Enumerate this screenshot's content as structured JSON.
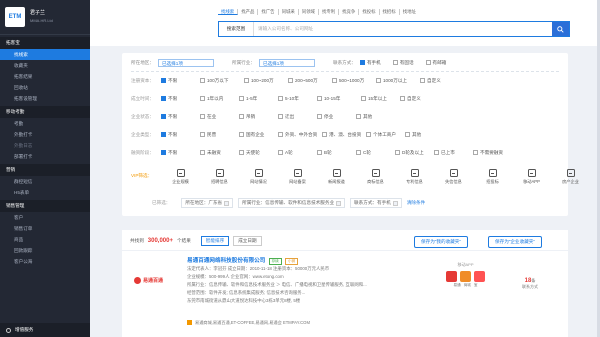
{
  "app": {
    "name": "君子兰",
    "sub": "MMA.HR.Ltd",
    "logo": "ETM"
  },
  "sidebar": {
    "sections": [
      {
        "title": "拓客宝",
        "items": [
          "找线索",
          "收藏夹",
          "拓客结果",
          "回收站",
          "拓客设管理"
        ]
      },
      {
        "title": "移动考勤",
        "items": [
          "考勤",
          "外勤打卡",
          "外勤日志",
          "部署打卡"
        ]
      },
      {
        "title": "营销",
        "items": [
          "群控短信",
          "H5表单"
        ]
      },
      {
        "title": "销售管理",
        "items": [
          "客户",
          "销售订单",
          "商品",
          "回款跟踪",
          "客户公海"
        ]
      }
    ],
    "active": "找线索",
    "dim": [
      "外勤日志"
    ],
    "bottom": "增值服务"
  },
  "top": {
    "tabs": [
      "找线索",
      "找产品",
      "找广告",
      "同城采",
      "同领域",
      "找专利",
      "找竞争",
      "找投标",
      "找招标",
      "找地址"
    ],
    "active": "找线索",
    "search_select": "搜索范围",
    "search_placeholder": "请输入公司名称、公司网址"
  },
  "filter": {
    "region_label": "所在地区：",
    "region_value": "已选择1项",
    "industry_label": "所属行业：",
    "industry_value": "已选择1项",
    "contact_label": "联系方式：",
    "contact_opts": [
      {
        "t": "有手机",
        "on": true
      },
      {
        "t": "有固话",
        "on": false
      },
      {
        "t": "有邮箱",
        "on": false
      }
    ],
    "rows": [
      {
        "label": "注册资本：",
        "opts": [
          "不限",
          "100万以下",
          "100~200万",
          "200~500万",
          "500~1000万",
          "1000万以上",
          "自定义"
        ]
      },
      {
        "label": "成立时间：",
        "opts": [
          "不限",
          "1年以内",
          "1-5年",
          "5-10年",
          "10-15年",
          "15年以上",
          "自定义"
        ]
      },
      {
        "label": "企业状态：",
        "opts": [
          "不限",
          "在业",
          "吊销",
          "迁出",
          "停业",
          "其他"
        ]
      },
      {
        "label": "企业类型：",
        "opts": [
          "不限",
          "民营",
          "国有企业",
          "外资、中外合资",
          "港、澳、台投资",
          "个体工商户",
          "其他"
        ]
      },
      {
        "label": "融资阶段：",
        "opts": [
          "不限",
          "未融资",
          "天使轮",
          "A轮",
          "B轮",
          "C轮",
          "D轮及以上",
          "已上市",
          "不需要融资"
        ]
      }
    ],
    "vip_label": "VIP筛选：",
    "vip_items": [
      "企业规模",
      "招聘信息",
      "网站情况",
      "网站备案",
      "新闻报道",
      "商标信息",
      "专利信息",
      "失信信息",
      "招投标",
      "移动APP",
      "房产企业"
    ],
    "chosen_label": "已筛选：",
    "chips": [
      "所在地区：广东省",
      "所属行业：信息传输、软件和信息技术服务业",
      "联系方式：有手机"
    ],
    "clear": "清除条件"
  },
  "results": {
    "prefix": "共找到",
    "count": "300,000+",
    "suffix": "个结果",
    "tabs": [
      "智能排序",
      "成立日期"
    ],
    "active_tab": "智能排序",
    "save1": "保存为\"我的收藏夹\"",
    "save2": "保存为\"企业收藏夹\"",
    "company": {
      "logo": "易通百通",
      "name": "易通百通网络科技股份有限公司",
      "badge1": "存续",
      "badge2": "小微",
      "line1": "法定代表人：李冠芬   成立日期：2010-11-18   注册资本：50000万元人民币",
      "line2": "企业规模：500-999人   企业官网：www.etong.com",
      "line3": "所属行业：信息传输、软件和信息技术服务业 ＞ 电信、广播电视和卫星传输服务, 互联网和...",
      "line4": "经营范围：软件开发; 信息系统集成服务; 信息技术咨询服务...",
      "line5": "东莞市南城街道从鼎山大道悦达科技中心3栋3单元8楼, 5楼",
      "apps_title": "移动APP",
      "apps": [
        "易通",
        "商城",
        "宝"
      ],
      "contact_num": "18",
      "contact_unit": "条",
      "contact_label": "联系方式",
      "footer": "易通商城,易通百通,ET-COFFEE,易通网,易通会 ETMPAY.COM"
    }
  }
}
